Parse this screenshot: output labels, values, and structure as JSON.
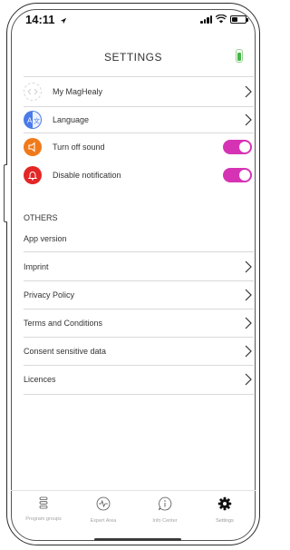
{
  "status": {
    "time": "14:11"
  },
  "header": {
    "title": "SETTINGS"
  },
  "settings": [
    {
      "label": "My MagHealy",
      "type": "link"
    },
    {
      "label": "Language",
      "type": "link"
    },
    {
      "label": "Turn off sound",
      "type": "toggle",
      "on": true
    },
    {
      "label": "Disable notification",
      "type": "toggle",
      "on": true
    }
  ],
  "others": {
    "title": "OTHERS",
    "app_version": "App version",
    "items": [
      "Imprint",
      "Privacy Policy",
      "Terms and Conditions",
      "Consent sensitive data",
      "Licences"
    ]
  },
  "tabs": [
    {
      "label": "Program groups",
      "icon": "list-icon"
    },
    {
      "label": "Expert Area",
      "icon": "pulse-icon"
    },
    {
      "label": "Info Center",
      "icon": "info-icon"
    },
    {
      "label": "Settings",
      "icon": "gear-icon",
      "active": true
    }
  ],
  "colors": {
    "toggle_on": "#d633b4",
    "sound_icon": "#f07a1a",
    "notification_icon": "#e32626",
    "language_icon": "#4a7be8"
  }
}
